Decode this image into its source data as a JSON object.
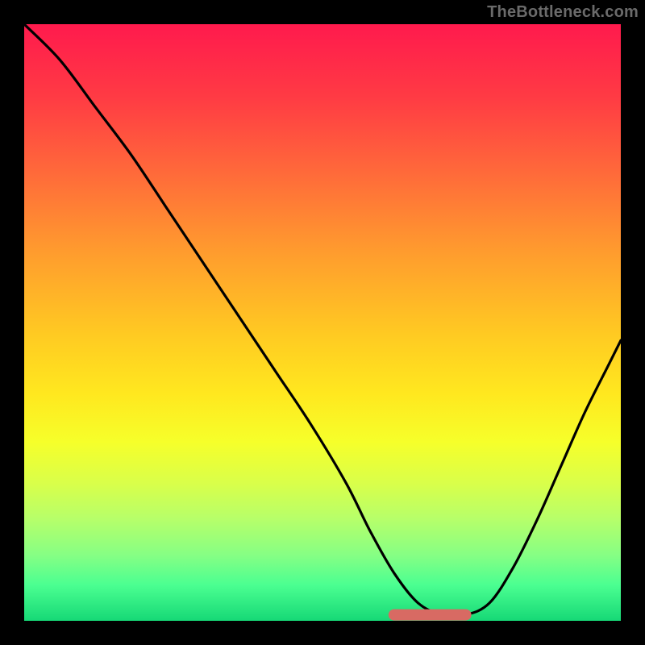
{
  "watermark": "TheBottleneck.com",
  "colors": {
    "frame": "#000000",
    "curve_stroke": "#000000",
    "trough_marker": "#d86a63",
    "gradient_top": "#ff1a4d",
    "gradient_bottom": "#16d876"
  },
  "chart_data": {
    "type": "line",
    "title": "",
    "xlabel": "",
    "ylabel": "",
    "xlim": [
      0,
      100
    ],
    "ylim": [
      0,
      100
    ],
    "grid": false,
    "legend": false,
    "series": [
      {
        "name": "bottleneck-curve",
        "x": [
          0,
          6,
          12,
          18,
          24,
          30,
          36,
          42,
          48,
          54,
          58,
          62,
          66,
          70,
          74,
          78,
          82,
          86,
          90,
          94,
          98,
          100
        ],
        "y": [
          100,
          94,
          86,
          78,
          69,
          60,
          51,
          42,
          33,
          23,
          15,
          8,
          3,
          1,
          1,
          3,
          9,
          17,
          26,
          35,
          43,
          47
        ]
      }
    ],
    "trough_marker": {
      "x_start": 62,
      "x_end": 74,
      "y": 1
    },
    "annotations": []
  }
}
